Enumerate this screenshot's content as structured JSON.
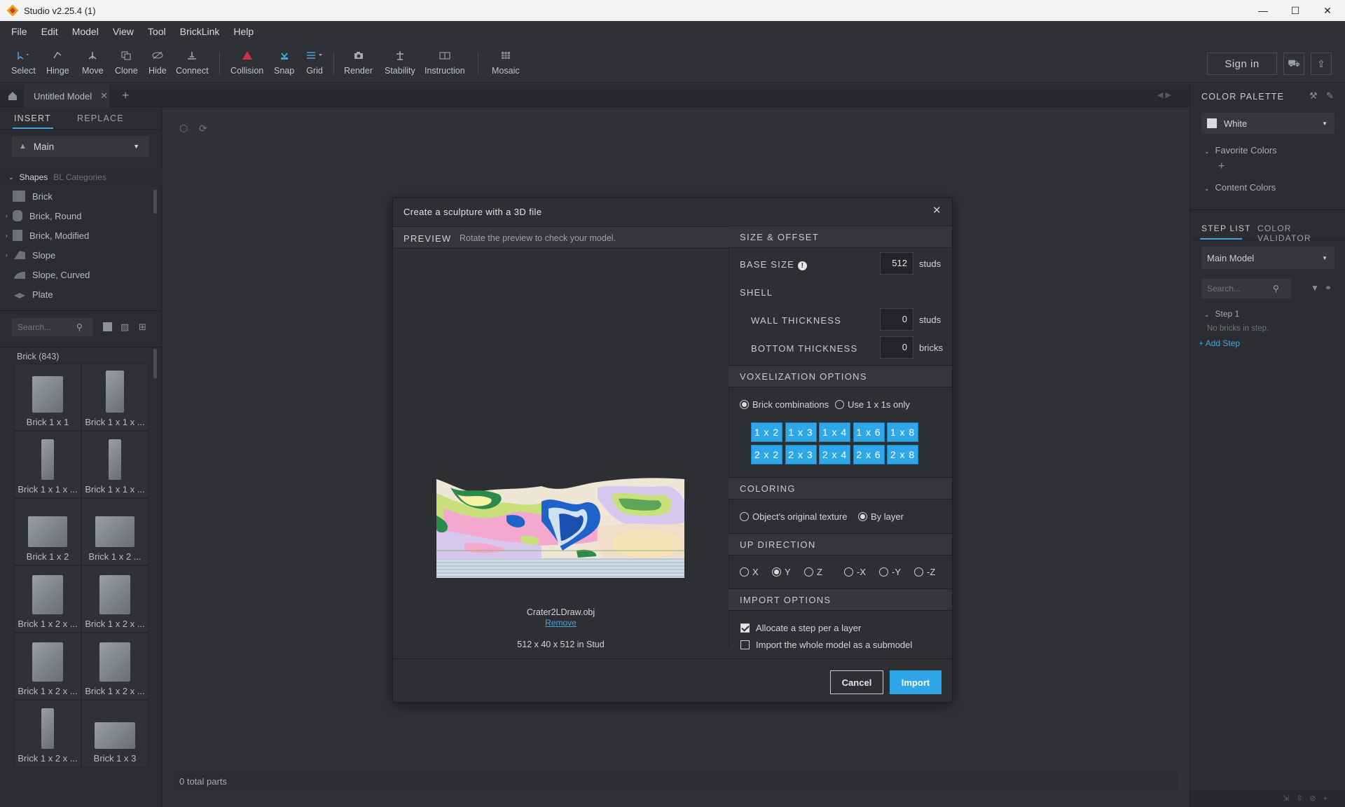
{
  "titlebar": {
    "title": "Studio v2.25.4 (1)",
    "minimize": "—",
    "maximize": "☐",
    "close": "✕"
  },
  "menu": [
    "File",
    "Edit",
    "Model",
    "View",
    "Tool",
    "BrickLink",
    "Help"
  ],
  "toolbar": {
    "tools": [
      "Select",
      "Hinge",
      "Move",
      "Clone",
      "Hide",
      "Connect",
      "Collision",
      "Snap",
      "Grid",
      "Render",
      "Stability",
      "Instruction",
      "Mosaic"
    ],
    "sign_in": "Sign in"
  },
  "tabs": {
    "model_tab": "Untitled Model",
    "add": "+"
  },
  "left": {
    "insert": "INSERT",
    "replace": "REPLACE",
    "main": "Main",
    "shapes": "Shapes",
    "bl_categories": "BL Categories",
    "categories": [
      "Brick",
      "Brick, Round",
      "Brick, Modified",
      "Slope",
      "Slope, Curved",
      "Plate"
    ],
    "search_placeholder": "Search...",
    "group_title": "Brick (843)",
    "parts": [
      "Brick 1 x 1",
      "Brick 1 x 1 x ...",
      "Brick 1 x 1 x ...",
      "Brick 1 x 1 x ...",
      "Brick 1 x 2",
      "Brick 1 x 2 ...",
      "Brick 1 x 2 x ...",
      "Brick 1 x 2 x ...",
      "Brick 1 x 2 x ...",
      "Brick 1 x 2 x ...",
      "Brick 1 x 2 x ...",
      "Brick 1 x 3"
    ]
  },
  "viewport": {
    "status": "0 total parts"
  },
  "right": {
    "color_palette": "COLOR PALETTE",
    "color": "White",
    "favorite_colors": "Favorite Colors",
    "add": "+",
    "content_colors": "Content Colors",
    "step_list": "STEP LIST",
    "color_validator": "COLOR VALIDATOR",
    "main_model": "Main Model",
    "search_placeholder": "Search...",
    "step1": "Step 1",
    "no_bricks": "No bricks in step.",
    "add_step": "Add Step"
  },
  "dialog": {
    "title": "Create a sculpture with a 3D file",
    "preview_label": "PREVIEW",
    "preview_hint": "Rotate the preview to check your model.",
    "filename": "Crater2LDraw.obj",
    "remove": "Remove",
    "dimensions": "512 x 40 x 512 in Stud",
    "size_offset": "SIZE & OFFSET",
    "base_size": "BASE SIZE",
    "base_size_value": "512",
    "studs": "studs",
    "shell": "SHELL",
    "wall_thickness": "WALL THICKNESS",
    "wall_value": "0",
    "wall_unit": "studs",
    "bottom_thickness": "BOTTOM THICKNESS",
    "bottom_value": "0",
    "bottom_unit": "bricks",
    "voxel": "VOXELIZATION OPTIONS",
    "brick_combos": "Brick combinations",
    "use_1x1": "Use 1 x 1s only",
    "chips": [
      "1 x 2",
      "1 x 3",
      "1 x 4",
      "1 x 6",
      "1 x 8",
      "2 x 2",
      "2 x 3",
      "2 x 4",
      "2 x 6",
      "2 x 8"
    ],
    "coloring": "COLORING",
    "orig_texture": "Object's original texture",
    "by_layer": "By layer",
    "up_direction": "UP DIRECTION",
    "directions": [
      "X",
      "Y",
      "Z",
      "-X",
      "-Y",
      "-Z"
    ],
    "import_options": "IMPORT OPTIONS",
    "alloc_step": "Allocate a step per a layer",
    "import_submodel": "Import the whole model as a submodel",
    "cancel": "Cancel",
    "import": "Import"
  },
  "colors": {
    "accent": "#2ea7e8",
    "selected_tab": "#4aa3d8"
  }
}
